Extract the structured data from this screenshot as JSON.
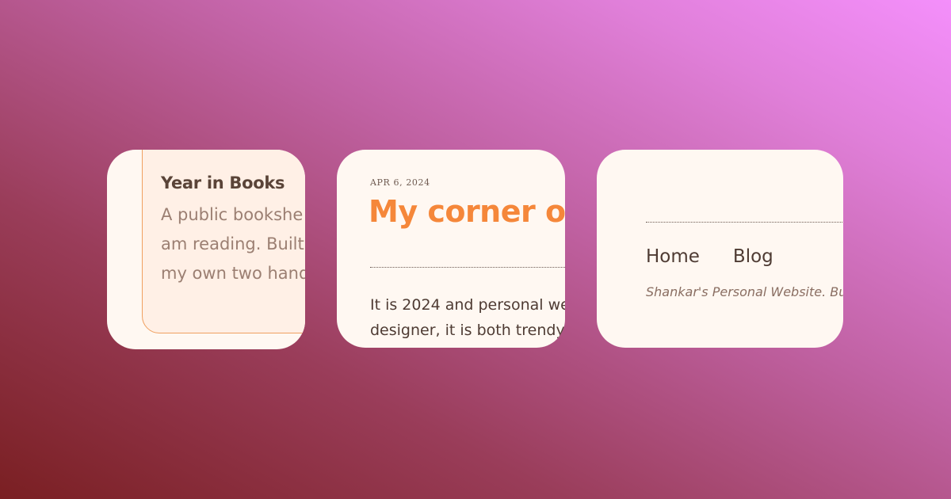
{
  "background": {
    "from": "#7a1f22",
    "to": "#f48ffb"
  },
  "cards": {
    "books": {
      "title": "Year in Books",
      "description_lines": [
        "A public bookshe",
        "am reading. Built",
        "my own two hand"
      ],
      "border_color": "#f0a060"
    },
    "post": {
      "date": "APR 6, 2024",
      "title": "My corner o",
      "body_lines": [
        "It is 2024 and personal we",
        "designer, it is both trendy"
      ],
      "accent": "#f5873a"
    },
    "footer": {
      "nav": [
        {
          "label": "Home"
        },
        {
          "label": "Blog"
        }
      ],
      "tagline": "Shankar's Personal Website. Bu"
    }
  }
}
